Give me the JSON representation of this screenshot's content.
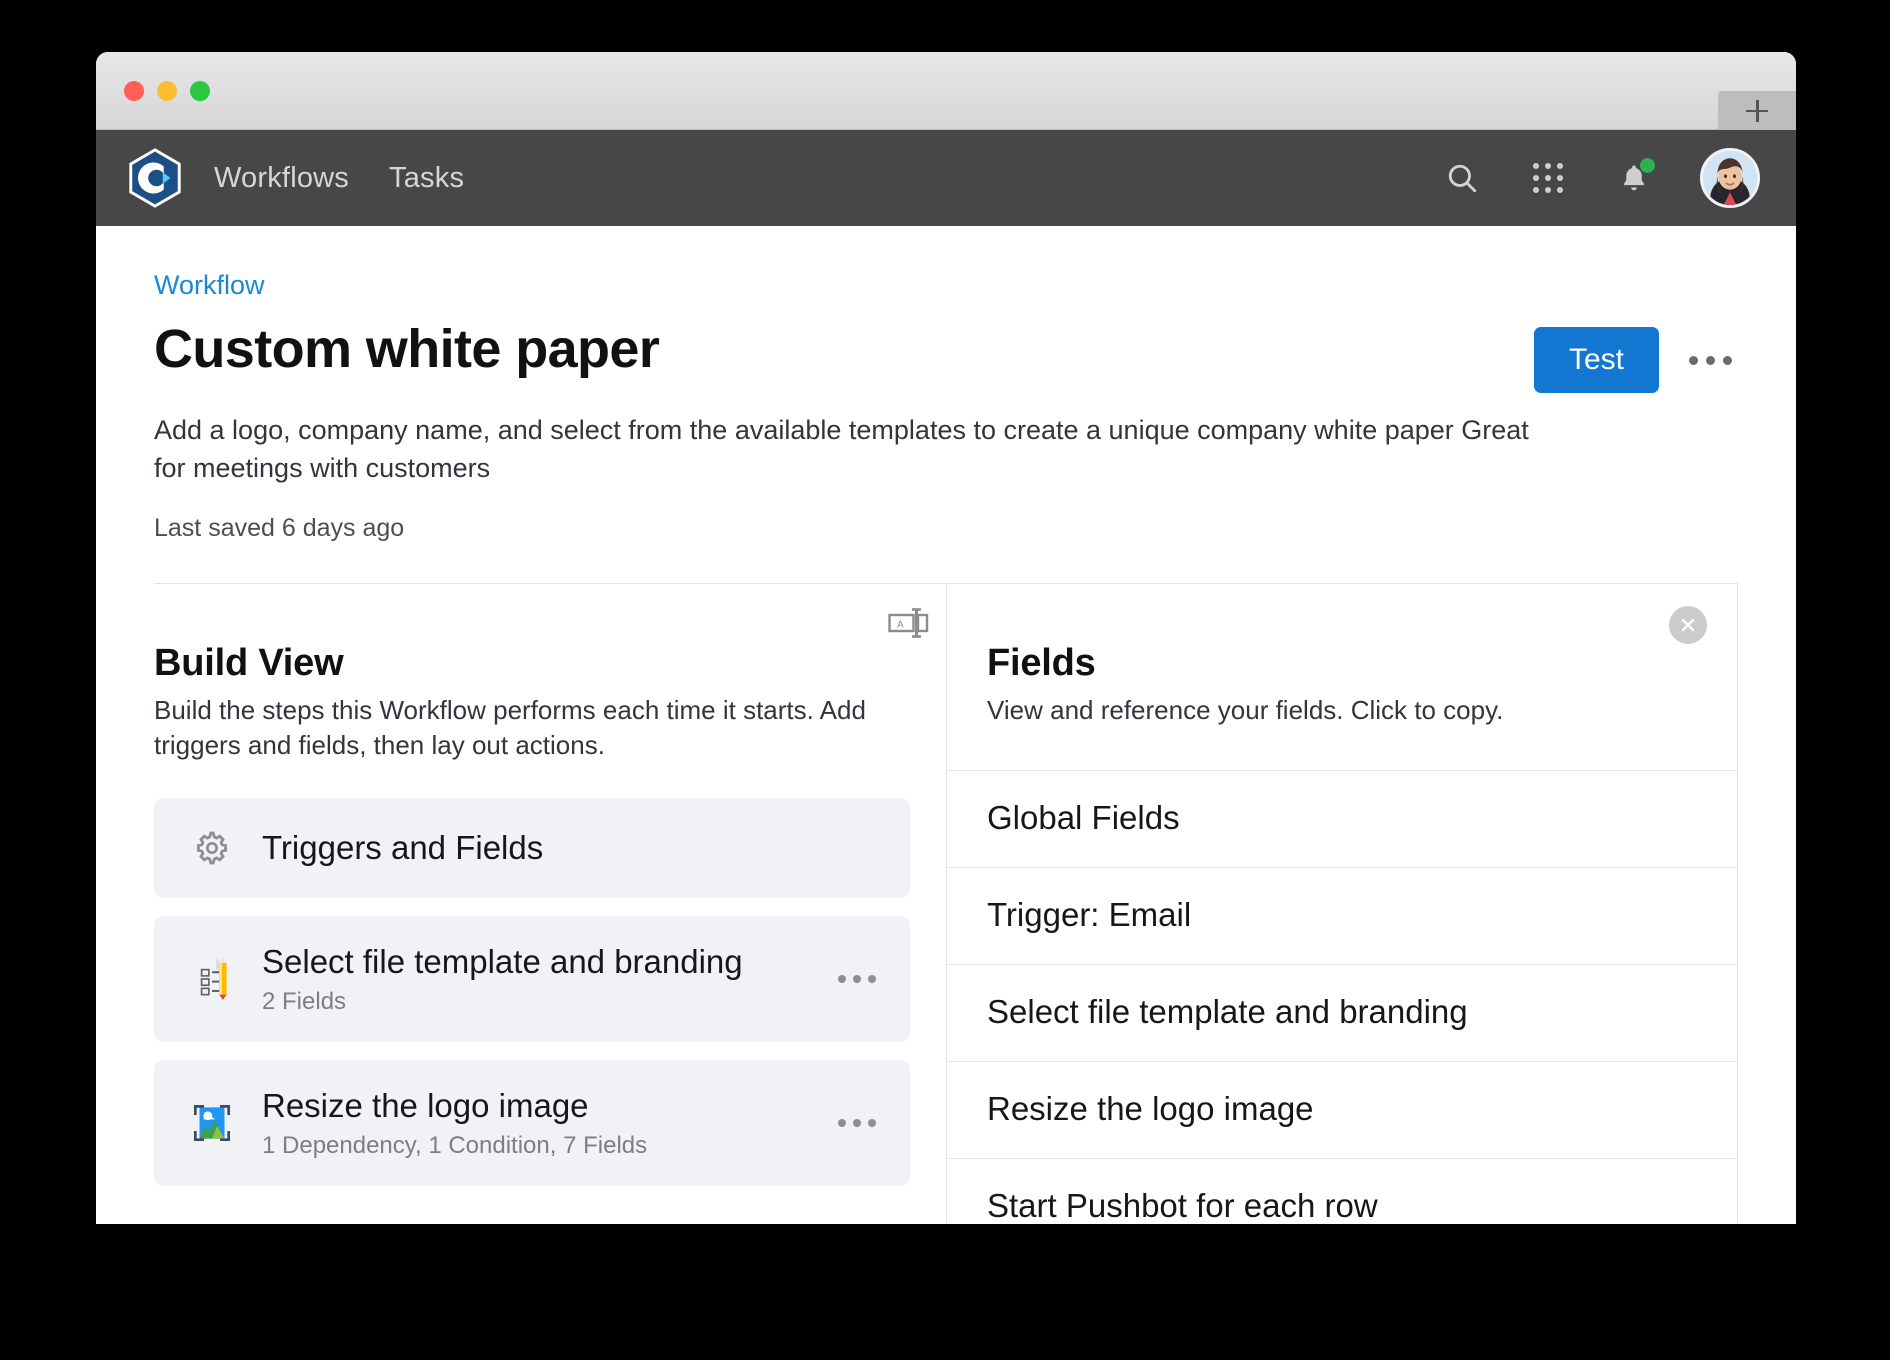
{
  "window": {
    "traffic_lights": [
      "close",
      "minimize",
      "zoom"
    ],
    "new_tab_label": "+"
  },
  "navbar": {
    "logo_name": "app-logo",
    "links": [
      {
        "label": "Workflows"
      },
      {
        "label": "Tasks"
      }
    ],
    "actions": [
      {
        "name": "search-icon"
      },
      {
        "name": "apps-grid-icon"
      },
      {
        "name": "notifications-bell-icon",
        "has_badge": true
      },
      {
        "name": "avatar"
      }
    ],
    "background": "#474747"
  },
  "page": {
    "breadcrumb": "Workflow",
    "title": "Custom white paper",
    "description": "Add a logo, company name, and select from the available templates to create a unique company white paper Great for meetings with customers",
    "last_saved": "Last saved 6 days ago",
    "test_button": "Test",
    "accent_color": "#1177d1",
    "link_color": "#1a88d8"
  },
  "build_view": {
    "heading": "Build View",
    "subtitle": "Build the steps this Workflow performs each time it starts. Add triggers and fields, then lay out actions.",
    "resize_handle_name": "pane-resize-handle",
    "steps": [
      {
        "title": "Triggers and Fields",
        "meta": "",
        "icon": "gear-icon",
        "has_kebab": false
      },
      {
        "title": "Select file template and branding",
        "meta": "2 Fields",
        "icon": "document-edit-icon",
        "has_kebab": true
      },
      {
        "title": "Resize the logo image",
        "meta": "1 Dependency, 1 Condition, 7 Fields",
        "icon": "image-resize-icon",
        "has_kebab": true
      }
    ]
  },
  "fields_panel": {
    "heading": "Fields",
    "subtitle": "View and reference your fields. Click to copy.",
    "close_label": "×",
    "rows": [
      {
        "label": "Global Fields"
      },
      {
        "label": "Trigger: Email"
      },
      {
        "label": "Select file template and branding"
      },
      {
        "label": "Resize the logo image"
      },
      {
        "label": "Start Pushbot for each row"
      }
    ]
  }
}
